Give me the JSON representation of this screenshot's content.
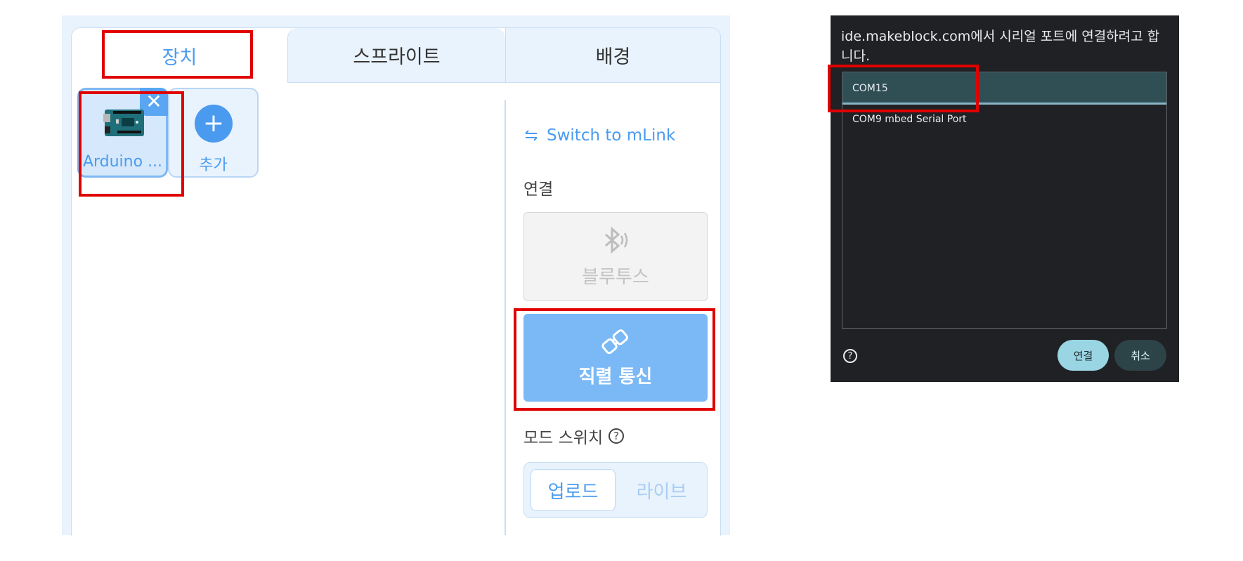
{
  "tabs": [
    {
      "label": "장치"
    },
    {
      "label": "스프라이트"
    },
    {
      "label": "배경"
    }
  ],
  "devices": {
    "arduino_label": "Arduino ...",
    "close_symbol": "✕",
    "add_symbol": "+",
    "add_label": "추가"
  },
  "connection": {
    "switch_link": "Switch to mLink",
    "section_label": "연결",
    "bluetooth_label": "블루투스",
    "serial_label": "직렬 통신",
    "mode_label": "모드 스위치",
    "help_symbol": "?",
    "mode_upload": "업로드",
    "mode_live": "라이브"
  },
  "dialog": {
    "title": "ide.makeblock.com에서 시리얼 포트에 연결하려고 합니다.",
    "ports": [
      "COM15",
      "COM9 mbed Serial Port"
    ],
    "help_symbol": "?",
    "connect_label": "연결",
    "cancel_label": "취소"
  },
  "colors": {
    "accent": "#4a9bf0",
    "highlight": "#e00000",
    "serial_button": "#7ab9f6",
    "dialog_bg": "#202124"
  }
}
